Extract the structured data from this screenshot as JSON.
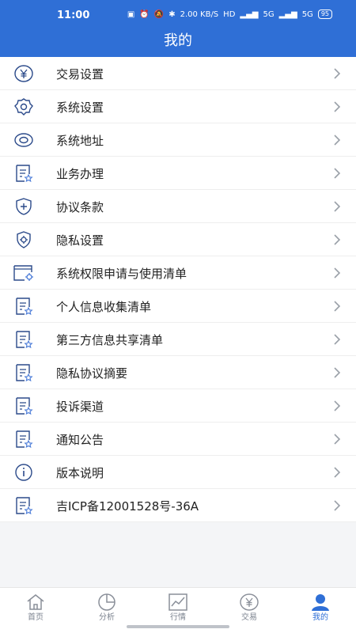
{
  "status": {
    "time": "11:00",
    "net_speed": "2.00 KB/S",
    "hd": "HD",
    "signal1": "5G",
    "signal2": "5G",
    "battery": "95"
  },
  "header": {
    "title": "我的"
  },
  "menu": [
    {
      "label": "交易设置",
      "icon": "yuan-circle-icon"
    },
    {
      "label": "系统设置",
      "icon": "gear-icon"
    },
    {
      "label": "系统地址",
      "icon": "eye-icon"
    },
    {
      "label": "业务办理",
      "icon": "document-star-icon"
    },
    {
      "label": "协议条款",
      "icon": "shield-plus-icon"
    },
    {
      "label": "隐私设置",
      "icon": "shield-gear-icon"
    },
    {
      "label": "系统权限申请与使用清单",
      "icon": "window-gear-icon"
    },
    {
      "label": "个人信息收集清单",
      "icon": "document-star-icon"
    },
    {
      "label": "第三方信息共享清单",
      "icon": "document-star-icon"
    },
    {
      "label": "隐私协议摘要",
      "icon": "document-star-icon"
    },
    {
      "label": "投诉渠道",
      "icon": "document-star-icon"
    },
    {
      "label": "通知公告",
      "icon": "document-star-icon"
    },
    {
      "label": "版本说明",
      "icon": "info-circle-icon"
    },
    {
      "label": "吉ICP备12001528号-36A",
      "icon": "document-star-icon"
    }
  ],
  "tabs": [
    {
      "label": "首页",
      "icon": "home-icon",
      "active": false
    },
    {
      "label": "分析",
      "icon": "pie-chart-icon",
      "active": false
    },
    {
      "label": "行情",
      "icon": "line-chart-icon",
      "active": false
    },
    {
      "label": "交易",
      "icon": "yuan-circle-icon",
      "active": false
    },
    {
      "label": "我的",
      "icon": "user-icon",
      "active": true
    }
  ],
  "colors": {
    "primary": "#2f6fd6",
    "icon": "#2b4a8a"
  }
}
